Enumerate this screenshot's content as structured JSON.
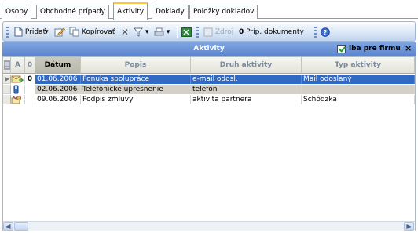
{
  "tabs": [
    {
      "label": "Osoby"
    },
    {
      "label": "Obchodné prípady"
    },
    {
      "label": "Aktivity",
      "active": true
    },
    {
      "label": "Doklady"
    },
    {
      "label": "Položky dokladov"
    }
  ],
  "toolbar": {
    "add_label": "Pridať",
    "copy_label": "Kopírovať",
    "source_label": "Zdroj",
    "attachments_label": "Príp. dokumenty"
  },
  "panel": {
    "title": "Aktivity",
    "filter_label": "iba pre firmu",
    "filter_checked": true,
    "close_label": "×"
  },
  "grid": {
    "columns": {
      "a": "A",
      "attach": "0",
      "date": "Dátum",
      "desc": "Popis",
      "kind": "Druh aktivity",
      "type": "Typ aktivity"
    },
    "rows": [
      {
        "date": "01.06.2006",
        "desc": "Ponuka spolupráce",
        "kind": "e-mail odosl.",
        "type": "Mail odoslaný",
        "attach": "0",
        "selected": true,
        "icon": "mail-icon"
      },
      {
        "date": "02.06.2006",
        "desc": "Telefonické upresnenie",
        "kind": "telefón",
        "type": "",
        "attach": "",
        "icon": "phone-icon"
      },
      {
        "date": "09.06.2006",
        "desc": "Podpis zmluvy",
        "kind": "aktivita partnera",
        "type": "Schôdzka",
        "attach": "",
        "icon": "meeting-icon"
      }
    ]
  },
  "colors": {
    "header_blue": "#5b84cc",
    "selection": "#316ac5",
    "tab_accent": "#ffc83c"
  }
}
